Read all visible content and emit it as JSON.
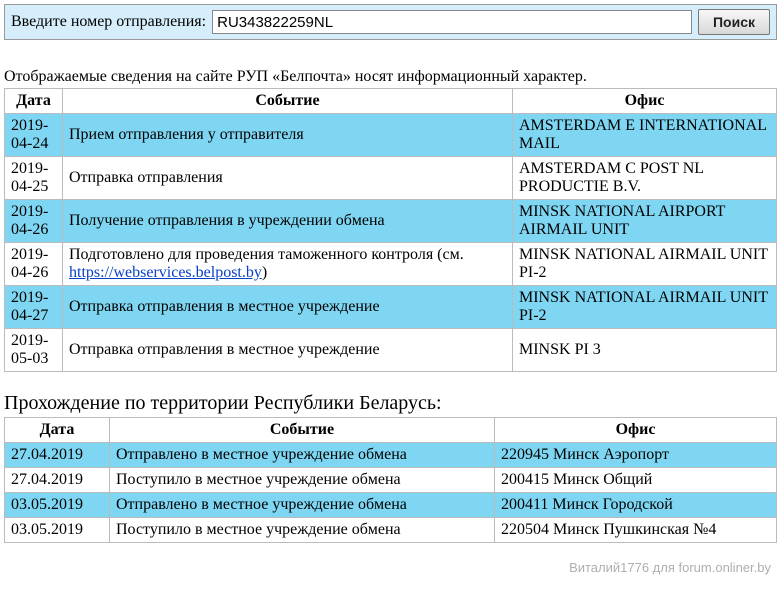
{
  "search": {
    "label": "Введите номер отправления:",
    "value": "RU343822259NL",
    "button": "Поиск"
  },
  "info_line": "Отображаемые сведения на сайте РУП «Белпочта» носят информационный характер.",
  "table1": {
    "headers": {
      "date": "Дата",
      "event": "Событие",
      "office": "Офис"
    },
    "rows": [
      {
        "date": "2019-04-24",
        "event_text": "Прием отправления у отправителя",
        "event_link": "",
        "office": "AMSTERDAM E INTERNATIONAL MAIL"
      },
      {
        "date": "2019-04-25",
        "event_text": "Отправка отправления",
        "event_link": "",
        "office": "AMSTERDAM C POST NL PRODUCTIE B.V."
      },
      {
        "date": "2019-04-26",
        "event_text": "Получение отправления в учреждении обмена",
        "event_link": "",
        "office": "MINSK NATIONAL AIRPORT AIRMAIL UNIT"
      },
      {
        "date": "2019-04-26",
        "event_text": "Подготовлено для проведения таможенного контроля (см. ",
        "event_link": "https://webservices.belpost.by",
        "event_text_after": ")",
        "office": "MINSK NATIONAL AIRMAIL UNIT PI-2"
      },
      {
        "date": "2019-04-27",
        "event_text": "Отправка отправления в местное учреждение",
        "event_link": "",
        "office": "MINSK NATIONAL AIRMAIL UNIT PI-2"
      },
      {
        "date": "2019-05-03",
        "event_text": "Отправка отправления в местное учреждение",
        "event_link": "",
        "office": "MINSK PI 3"
      }
    ]
  },
  "section2_title": "Прохождение по территории Республики Беларусь:",
  "table2": {
    "headers": {
      "date": "Дата",
      "event": "Событие",
      "office": "Офис"
    },
    "rows": [
      {
        "date": "27.04.2019",
        "event": "Отправлено в местное учреждение обмена",
        "office": "220945 Минск Аэропорт"
      },
      {
        "date": "27.04.2019",
        "event": "Поступило в местное учреждение обмена",
        "office": "200415 Минск Общий"
      },
      {
        "date": "03.05.2019",
        "event": "Отправлено в местное учреждение обмена",
        "office": "200411 Минск Городской"
      },
      {
        "date": "03.05.2019",
        "event": "Поступило в местное учреждение обмена",
        "office": "220504 Минск Пушкинская №4"
      }
    ]
  },
  "watermark": "Виталий1776 для forum.onliner.by"
}
